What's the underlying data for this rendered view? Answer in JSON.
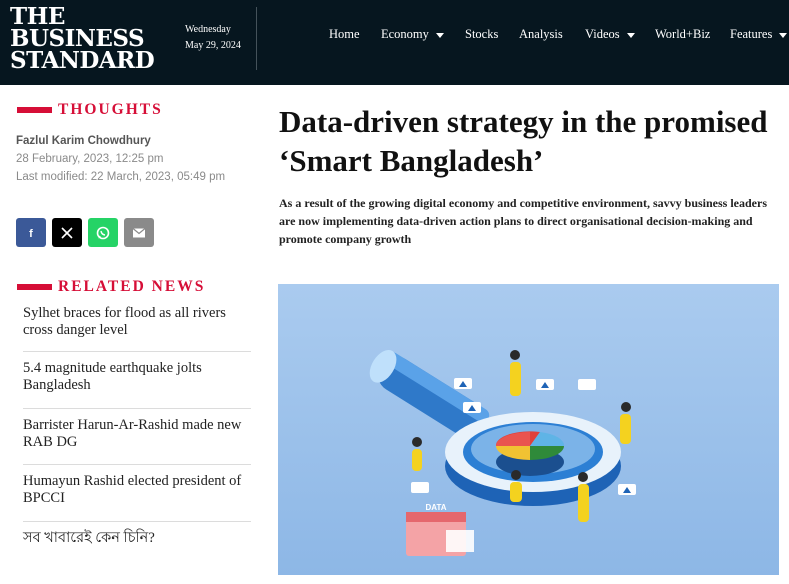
{
  "header": {
    "logo_lines": [
      "THE",
      "BUSINESS",
      "STANDARD"
    ],
    "date_day": "Wednesday",
    "date_full": "May 29, 2024",
    "nav": [
      {
        "label": "Home",
        "dropdown": false
      },
      {
        "label": "Economy",
        "dropdown": true
      },
      {
        "label": "Stocks",
        "dropdown": false
      },
      {
        "label": "Analysis",
        "dropdown": false
      },
      {
        "label": "Videos",
        "dropdown": true
      },
      {
        "label": "World+Biz",
        "dropdown": false
      },
      {
        "label": "Features",
        "dropdown": true
      }
    ]
  },
  "sidebar": {
    "section_label": "THOUGHTS",
    "author": "Fazlul Karim Chowdhury",
    "published": "28 February, 2023, 12:25 pm",
    "modified": "Last modified: 22 March, 2023, 05:49 pm",
    "share_buttons": [
      {
        "name": "facebook-icon",
        "color": "#3b5998"
      },
      {
        "name": "x-icon",
        "color": "#000000"
      },
      {
        "name": "whatsapp-icon",
        "color": "#25d366"
      },
      {
        "name": "email-icon",
        "color": "#888888"
      }
    ],
    "related_label": "RELATED NEWS",
    "related": [
      "Sylhet braces for flood as all rivers cross danger level",
      "5.4 magnitude earthquake jolts Bangladesh",
      "Barrister Harun-Ar-Rashid made new RAB DG",
      "Humayun Rashid elected president of BPCCI",
      "সব খাবারেই কেন চিনি?"
    ]
  },
  "article": {
    "headline": "Data-driven strategy in the promised ‘Smart Bangladesh’",
    "summary": "As a result of the growing digital economy and competitive environment, savvy business leaders are now implementing data-driven action plans to direct organisational decision-making and promote company growth",
    "illustration_text": "DATA"
  },
  "colors": {
    "header_bg": "#06161f",
    "accent_red": "#d60e37",
    "hero_bg": "#9fc4ea"
  }
}
